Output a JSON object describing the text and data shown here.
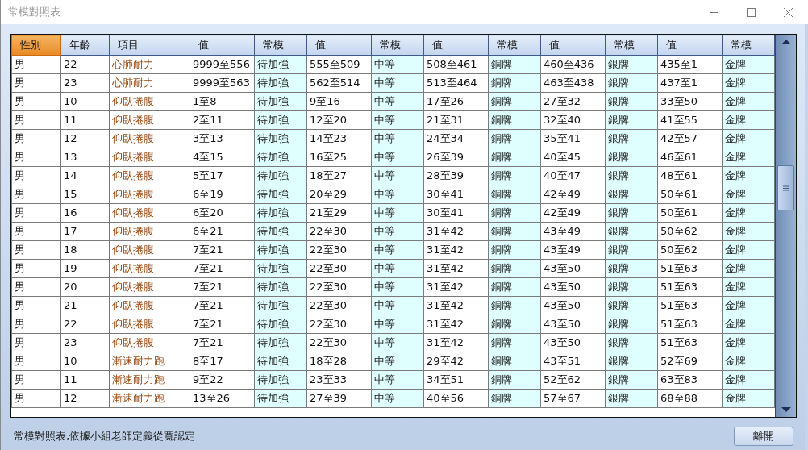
{
  "window": {
    "title": "常模對照表"
  },
  "table": {
    "columns": [
      {
        "label": "性別",
        "selected": true,
        "kind": "plain"
      },
      {
        "label": "年齡",
        "selected": false,
        "kind": "plain"
      },
      {
        "label": "項目",
        "selected": false,
        "kind": "item"
      },
      {
        "label": "值",
        "selected": false,
        "kind": "plain"
      },
      {
        "label": "常模",
        "selected": false,
        "kind": "norm"
      },
      {
        "label": "值",
        "selected": false,
        "kind": "plain"
      },
      {
        "label": "常模",
        "selected": false,
        "kind": "norm"
      },
      {
        "label": "值",
        "selected": false,
        "kind": "plain"
      },
      {
        "label": "常模",
        "selected": false,
        "kind": "norm"
      },
      {
        "label": "值",
        "selected": false,
        "kind": "plain"
      },
      {
        "label": "常模",
        "selected": false,
        "kind": "norm"
      },
      {
        "label": "值",
        "selected": false,
        "kind": "plain"
      },
      {
        "label": "常模",
        "selected": false,
        "kind": "norm"
      }
    ],
    "rows": [
      [
        "男",
        "22",
        "心肺耐力",
        "9999至556",
        "待加強",
        "555至509",
        "中等",
        "508至461",
        "銅牌",
        "460至436",
        "銀牌",
        "435至1",
        "金牌"
      ],
      [
        "男",
        "23",
        "心肺耐力",
        "9999至563",
        "待加強",
        "562至514",
        "中等",
        "513至464",
        "銅牌",
        "463至438",
        "銀牌",
        "437至1",
        "金牌"
      ],
      [
        "男",
        "10",
        "仰臥捲腹",
        "1至8",
        "待加強",
        "9至16",
        "中等",
        "17至26",
        "銅牌",
        "27至32",
        "銀牌",
        "33至50",
        "金牌"
      ],
      [
        "男",
        "11",
        "仰臥捲腹",
        "2至11",
        "待加強",
        "12至20",
        "中等",
        "21至31",
        "銅牌",
        "32至40",
        "銀牌",
        "41至55",
        "金牌"
      ],
      [
        "男",
        "12",
        "仰臥捲腹",
        "3至13",
        "待加強",
        "14至23",
        "中等",
        "24至34",
        "銅牌",
        "35至41",
        "銀牌",
        "42至57",
        "金牌"
      ],
      [
        "男",
        "13",
        "仰臥捲腹",
        "4至15",
        "待加強",
        "16至25",
        "中等",
        "26至39",
        "銅牌",
        "40至45",
        "銀牌",
        "46至61",
        "金牌"
      ],
      [
        "男",
        "14",
        "仰臥捲腹",
        "5至17",
        "待加強",
        "18至27",
        "中等",
        "28至39",
        "銅牌",
        "40至47",
        "銀牌",
        "48至61",
        "金牌"
      ],
      [
        "男",
        "15",
        "仰臥捲腹",
        "6至19",
        "待加強",
        "20至29",
        "中等",
        "30至41",
        "銅牌",
        "42至49",
        "銀牌",
        "50至61",
        "金牌"
      ],
      [
        "男",
        "16",
        "仰臥捲腹",
        "6至20",
        "待加強",
        "21至29",
        "中等",
        "30至41",
        "銅牌",
        "42至49",
        "銀牌",
        "50至61",
        "金牌"
      ],
      [
        "男",
        "17",
        "仰臥捲腹",
        "6至21",
        "待加強",
        "22至30",
        "中等",
        "31至42",
        "銅牌",
        "43至49",
        "銀牌",
        "50至62",
        "金牌"
      ],
      [
        "男",
        "18",
        "仰臥捲腹",
        "7至21",
        "待加強",
        "22至30",
        "中等",
        "31至42",
        "銅牌",
        "43至49",
        "銀牌",
        "50至62",
        "金牌"
      ],
      [
        "男",
        "19",
        "仰臥捲腹",
        "7至21",
        "待加強",
        "22至30",
        "中等",
        "31至42",
        "銅牌",
        "43至50",
        "銀牌",
        "51至63",
        "金牌"
      ],
      [
        "男",
        "20",
        "仰臥捲腹",
        "7至21",
        "待加強",
        "22至30",
        "中等",
        "31至42",
        "銅牌",
        "43至50",
        "銀牌",
        "51至63",
        "金牌"
      ],
      [
        "男",
        "21",
        "仰臥捲腹",
        "7至21",
        "待加強",
        "22至30",
        "中等",
        "31至42",
        "銅牌",
        "43至50",
        "銀牌",
        "51至63",
        "金牌"
      ],
      [
        "男",
        "22",
        "仰臥捲腹",
        "7至21",
        "待加強",
        "22至30",
        "中等",
        "31至42",
        "銅牌",
        "43至50",
        "銀牌",
        "51至63",
        "金牌"
      ],
      [
        "男",
        "23",
        "仰臥捲腹",
        "7至21",
        "待加強",
        "22至30",
        "中等",
        "31至42",
        "銅牌",
        "43至50",
        "銀牌",
        "51至63",
        "金牌"
      ],
      [
        "男",
        "10",
        "漸速耐力跑",
        "8至17",
        "待加強",
        "18至28",
        "中等",
        "29至42",
        "銅牌",
        "43至51",
        "銀牌",
        "52至69",
        "金牌"
      ],
      [
        "男",
        "11",
        "漸速耐力跑",
        "9至22",
        "待加強",
        "23至33",
        "中等",
        "34至51",
        "銅牌",
        "52至62",
        "銀牌",
        "63至83",
        "金牌"
      ],
      [
        "男",
        "12",
        "漸速耐力跑",
        "13至26",
        "待加強",
        "27至39",
        "中等",
        "40至56",
        "銅牌",
        "57至67",
        "銀牌",
        "68至88",
        "金牌"
      ]
    ]
  },
  "status_text": "常模對照表,依據小組老師定義從寬認定",
  "buttons": [
    "離開"
  ]
}
